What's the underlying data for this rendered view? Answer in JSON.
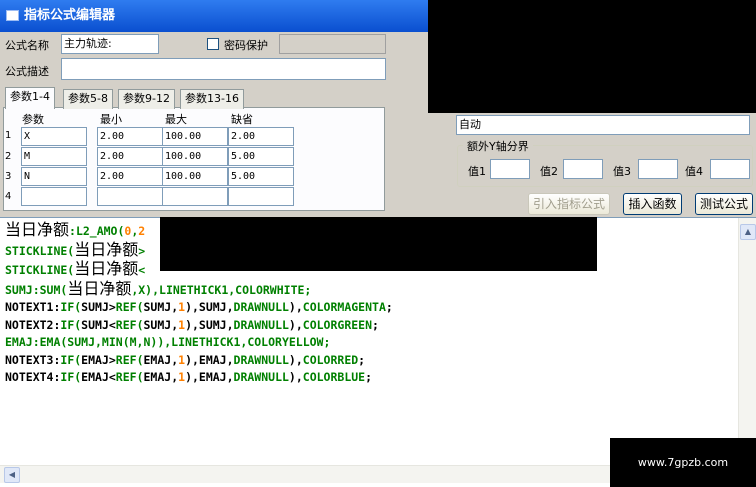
{
  "window": {
    "title": "指标公式编辑器"
  },
  "form": {
    "name_label": "公式名称",
    "name_value": "主力轨迹:",
    "password_label": "密码保护",
    "desc_label": "公式描述",
    "desc_value": ""
  },
  "tabs": [
    "参数1-4",
    "参数5-8",
    "参数9-12",
    "参数13-16"
  ],
  "params": {
    "headers": [
      "参数",
      "最小",
      "最大",
      "缺省"
    ],
    "rows": [
      {
        "num": "1",
        "name": "X",
        "min": "2.00",
        "max": "100.00",
        "default": "2.00"
      },
      {
        "num": "2",
        "name": "M",
        "min": "2.00",
        "max": "100.00",
        "default": "5.00"
      },
      {
        "num": "3",
        "name": "N",
        "min": "2.00",
        "max": "100.00",
        "default": "5.00"
      },
      {
        "num": "4",
        "name": "",
        "min": "",
        "max": "",
        "default": ""
      }
    ]
  },
  "axis": {
    "mode_value": "自动",
    "group_title": "额外Y轴分界",
    "labels": [
      "值1",
      "值2",
      "值3",
      "值4"
    ]
  },
  "buttons": {
    "import": "引入指标公式",
    "insert_func": "插入函数",
    "test": "测试公式"
  },
  "code_lines": [
    [
      [
        "zh",
        "当日净额"
      ],
      [
        "kw",
        ":L2_AMO("
      ],
      [
        "num",
        "0"
      ],
      [
        "kw",
        ","
      ],
      [
        "num",
        "2"
      ]
    ],
    [
      [
        "kw",
        "STICKLINE("
      ],
      [
        "zh",
        "当日净额"
      ],
      [
        "kw",
        ">"
      ]
    ],
    [
      [
        "kw",
        "STICKLINE("
      ],
      [
        "zh",
        "当日净额"
      ],
      [
        "kw",
        "<"
      ]
    ],
    [
      [
        "kw",
        "SUMJ:SUM("
      ],
      [
        "zh",
        "当日净额"
      ],
      [
        "kw",
        ",X),LINETHICK1,COLORWHITE;"
      ]
    ],
    [
      [
        "bk",
        "NOTEXT1:"
      ],
      [
        "kw",
        "IF("
      ],
      [
        "bk",
        "SUMJ>"
      ],
      [
        "kw",
        "REF("
      ],
      [
        "bk",
        "SUMJ,"
      ],
      [
        "num",
        "1"
      ],
      [
        "bk",
        "),SUMJ,"
      ],
      [
        "kw",
        "DRAWNULL"
      ],
      [
        "bk",
        "),"
      ],
      [
        "kw",
        "COLORMAGENTA"
      ],
      [
        "bk",
        ";"
      ]
    ],
    [
      [
        "bk",
        "NOTEXT2:"
      ],
      [
        "kw",
        "IF("
      ],
      [
        "bk",
        "SUMJ<"
      ],
      [
        "kw",
        "REF("
      ],
      [
        "bk",
        "SUMJ,"
      ],
      [
        "num",
        "1"
      ],
      [
        "bk",
        "),SUMJ,"
      ],
      [
        "kw",
        "DRAWNULL"
      ],
      [
        "bk",
        "),"
      ],
      [
        "kw",
        "COLORGREEN"
      ],
      [
        "bk",
        ";"
      ]
    ],
    [
      [
        "kw",
        "EMAJ:EMA(SUMJ,MIN(M,N)),LINETHICK1,COLORYELLOW;"
      ]
    ],
    [
      [
        "bk",
        "NOTEXT3:"
      ],
      [
        "kw",
        "IF("
      ],
      [
        "bk",
        "EMAJ>"
      ],
      [
        "kw",
        "REF("
      ],
      [
        "bk",
        "EMAJ,"
      ],
      [
        "num",
        "1"
      ],
      [
        "bk",
        "),EMAJ,"
      ],
      [
        "kw",
        "DRAWNULL"
      ],
      [
        "bk",
        "),"
      ],
      [
        "kw",
        "COLORRED"
      ],
      [
        "bk",
        ";"
      ]
    ],
    [
      [
        "bk",
        "NOTEXT4:"
      ],
      [
        "kw",
        "IF("
      ],
      [
        "bk",
        "EMAJ<"
      ],
      [
        "kw",
        "REF("
      ],
      [
        "bk",
        "EMAJ,"
      ],
      [
        "num",
        "1"
      ],
      [
        "bk",
        "),EMAJ,"
      ],
      [
        "kw",
        "DRAWNULL"
      ],
      [
        "bk",
        "),"
      ],
      [
        "kw",
        "COLORBLUE"
      ],
      [
        "bk",
        ";"
      ]
    ]
  ],
  "watermark": "www.7gpzb.com"
}
